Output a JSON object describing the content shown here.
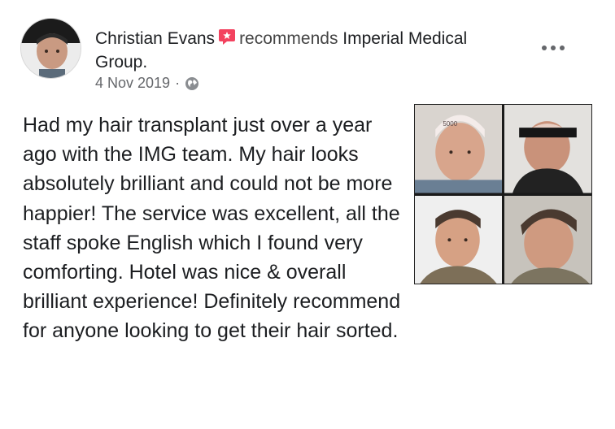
{
  "author": {
    "name": "Christian Evans",
    "action": "recommends",
    "page_name": "Imperial Medical Group."
  },
  "meta": {
    "date": "4 Nov 2019",
    "separator": "·",
    "privacy_icon": "globe-icon"
  },
  "menu": {
    "icon": "more-options-icon"
  },
  "recommend_icon": {
    "name": "recommend-icon",
    "color": "#f3425f"
  },
  "post": {
    "text": "Had my hair transplant just over a year ago with the IMG team. My hair looks absolutely brilliant and could not be more happier! The service was excellent, all the staff spoke English which I found very comforting. Hotel was nice & overall brilliant experience! Definitely recommend for anyone looking to get their hair sorted."
  },
  "photos": {
    "count": 4,
    "marker_text": "5000"
  }
}
